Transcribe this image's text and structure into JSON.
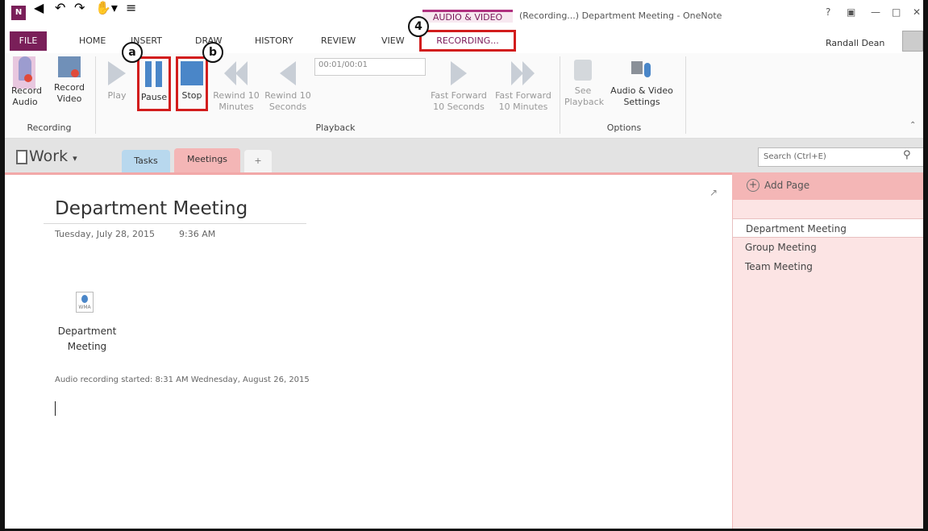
{
  "window": {
    "title": "(Recording...) Department Meeting - OneNote",
    "context_tab_group": "AUDIO & VIDEO",
    "user_name": "Randall Dean"
  },
  "tabs": [
    "FILE",
    "HOME",
    "INSERT",
    "DRAW",
    "HISTORY",
    "REVIEW",
    "VIEW"
  ],
  "context_tab": "RECORDING...",
  "ribbon": {
    "recording": {
      "record_audio": "Record Audio",
      "record_video": "Record Video",
      "group": "Recording"
    },
    "playback": {
      "play": "Play",
      "pause": "Pause",
      "stop": "Stop",
      "rewind10m": "Rewind 10 Minutes",
      "rewind10s": "Rewind 10 Seconds",
      "time": "00:01/00:01",
      "ff10s": "Fast Forward 10 Seconds",
      "ff10m": "Fast Forward 10 Minutes",
      "group": "Playback"
    },
    "options": {
      "see_playback": "See Playback",
      "settings": "Audio & Video Settings",
      "group": "Options"
    }
  },
  "callouts": {
    "a": "a",
    "b": "b",
    "step4": "4"
  },
  "notebook": {
    "name": "Work",
    "sections": [
      "Tasks",
      "Meetings",
      "+"
    ],
    "search_placeholder": "Search (Ctrl+E)"
  },
  "page": {
    "title": "Department Meeting",
    "date": "Tuesday, July 28, 2015",
    "time": "9:36 AM",
    "file_label": "Department Meeting",
    "file_type": "WMA",
    "note": "Audio recording started: 8:31 AM Wednesday, August 26, 2015"
  },
  "pages_panel": {
    "add_page": "Add Page",
    "pages": [
      "Department Meeting",
      "Group Meeting",
      "Team Meeting"
    ]
  },
  "colors": {
    "accent": "#7a1f59",
    "highlight": "#d21d1d",
    "section_meetings": "#f4b6b6",
    "section_tasks": "#b8d8ee"
  }
}
